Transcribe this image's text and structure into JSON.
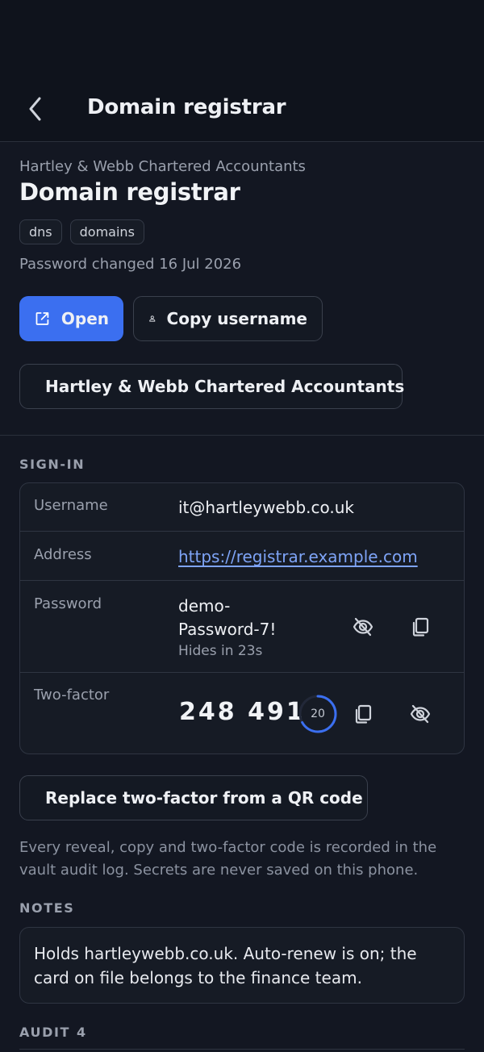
{
  "topbar": {
    "title": "Domain registrar",
    "back_icon": "chevron-left-icon"
  },
  "header": {
    "organization": "Hartley & Webb Chartered Accountants",
    "title": "Domain registrar",
    "tags": [
      "dns",
      "domains"
    ],
    "password_changed": "Password changed 16 Jul 2026"
  },
  "actions": {
    "open_label": "Open",
    "copy_username_label": "Copy username",
    "organization_label": "Hartley & Webb Chartered Accountants"
  },
  "signin": {
    "section_label": "SIGN-IN",
    "username_label": "Username",
    "username_value": "it@hartleywebb.co.uk",
    "address_label": "Address",
    "address_value": "https://registrar.example.com",
    "password_label": "Password",
    "password_line1": "demo-",
    "password_line2": "Password-7!",
    "password_hides": "Hides in 23s",
    "twofactor_label": "Two-factor",
    "twofactor_code": "248 491",
    "twofactor_seconds": "20",
    "twofactor_fraction": 0.67
  },
  "qr_button_label": "Replace two-factor from a QR code",
  "disclaimer": "Every reveal, copy and two-factor code is recorded in the vault audit log. Secrets are never saved on this phone.",
  "notes": {
    "section_label": "NOTES",
    "text": "Holds hartleywebb.co.uk. Auto-renew is on; the card on file belongs to the finance team."
  },
  "audit": {
    "section_label": "AUDIT",
    "count": "4"
  },
  "colors": {
    "accent": "#3b6ff0",
    "background": "#131722",
    "link": "#7ea4f7"
  }
}
